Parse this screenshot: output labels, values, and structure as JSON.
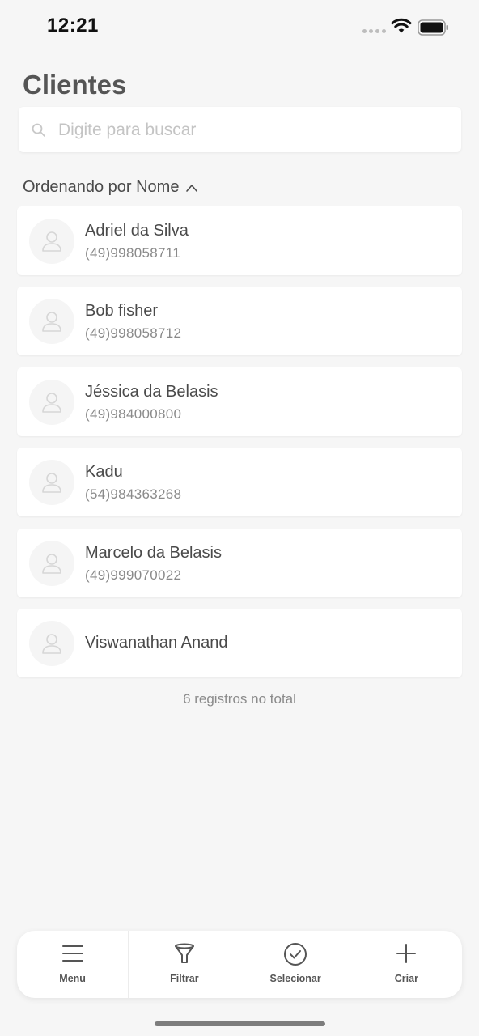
{
  "status_bar": {
    "time": "12:21"
  },
  "title": "Clientes",
  "search": {
    "placeholder": "Digite para buscar",
    "value": ""
  },
  "sort": {
    "label": "Ordenando por Nome",
    "direction_icon": "chevron-up-icon"
  },
  "clients": [
    {
      "name": "Adriel da Silva",
      "phone": "(49)998058711"
    },
    {
      "name": "Bob fisher",
      "phone": "(49)998058712"
    },
    {
      "name": "Jéssica da Belasis",
      "phone": "(49)984000800"
    },
    {
      "name": "Kadu",
      "phone": "(54)984363268"
    },
    {
      "name": "Marcelo da Belasis",
      "phone": "(49)999070022"
    },
    {
      "name": "Viswanathan Anand",
      "phone": ""
    }
  ],
  "total_label": "6 registros no total",
  "bottom_bar": {
    "menu_label": "Menu",
    "filter_label": "Filtrar",
    "select_label": "Selecionar",
    "create_label": "Criar"
  }
}
